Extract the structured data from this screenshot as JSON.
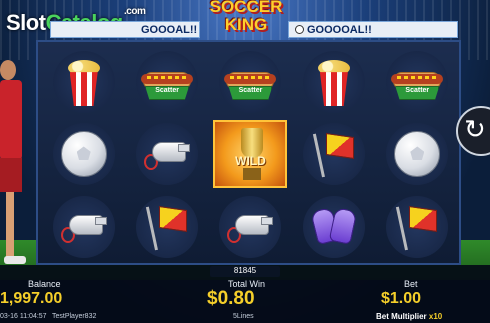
{
  "header": {
    "watermark_main": "Slot",
    "watermark_accent": "Catalog",
    "watermark_suffix": ".com",
    "game_title_line1": "SOCCER",
    "game_title_line2": "KING",
    "ticker_left": "GOOOAL!!",
    "ticker_right": "GOOOOAL!!"
  },
  "reels": [
    [
      "popcorn-icon",
      "hotdog-scatter-icon",
      "hotdog-scatter-icon",
      "popcorn-icon",
      "hotdog-scatter-icon"
    ],
    [
      "soccer-ball-icon",
      "whistle-icon",
      "wild-trophy-icon",
      "corner-flag-icon",
      "soccer-ball-icon"
    ],
    [
      "whistle-icon",
      "corner-flag-icon",
      "whistle-icon",
      "goalkeeper-gloves-icon",
      "corner-flag-icon"
    ]
  ],
  "symbols": {
    "scatter_label": "Scatter",
    "wild_label": "WILD"
  },
  "footer": {
    "last_win": "81845",
    "balance_label": "Balance",
    "balance_value": "1,997.00",
    "total_win_label": "Total Win",
    "total_win_value": "$0.80",
    "bet_label": "Bet",
    "bet_value": "$1.00",
    "timestamp": "03-16 11:04:57",
    "player": "TestPlayer832",
    "lines": "5Lines",
    "multiplier_label": "Bet Multiplier",
    "multiplier_value": "x10"
  },
  "spin_button": {
    "glyph": "↻"
  }
}
